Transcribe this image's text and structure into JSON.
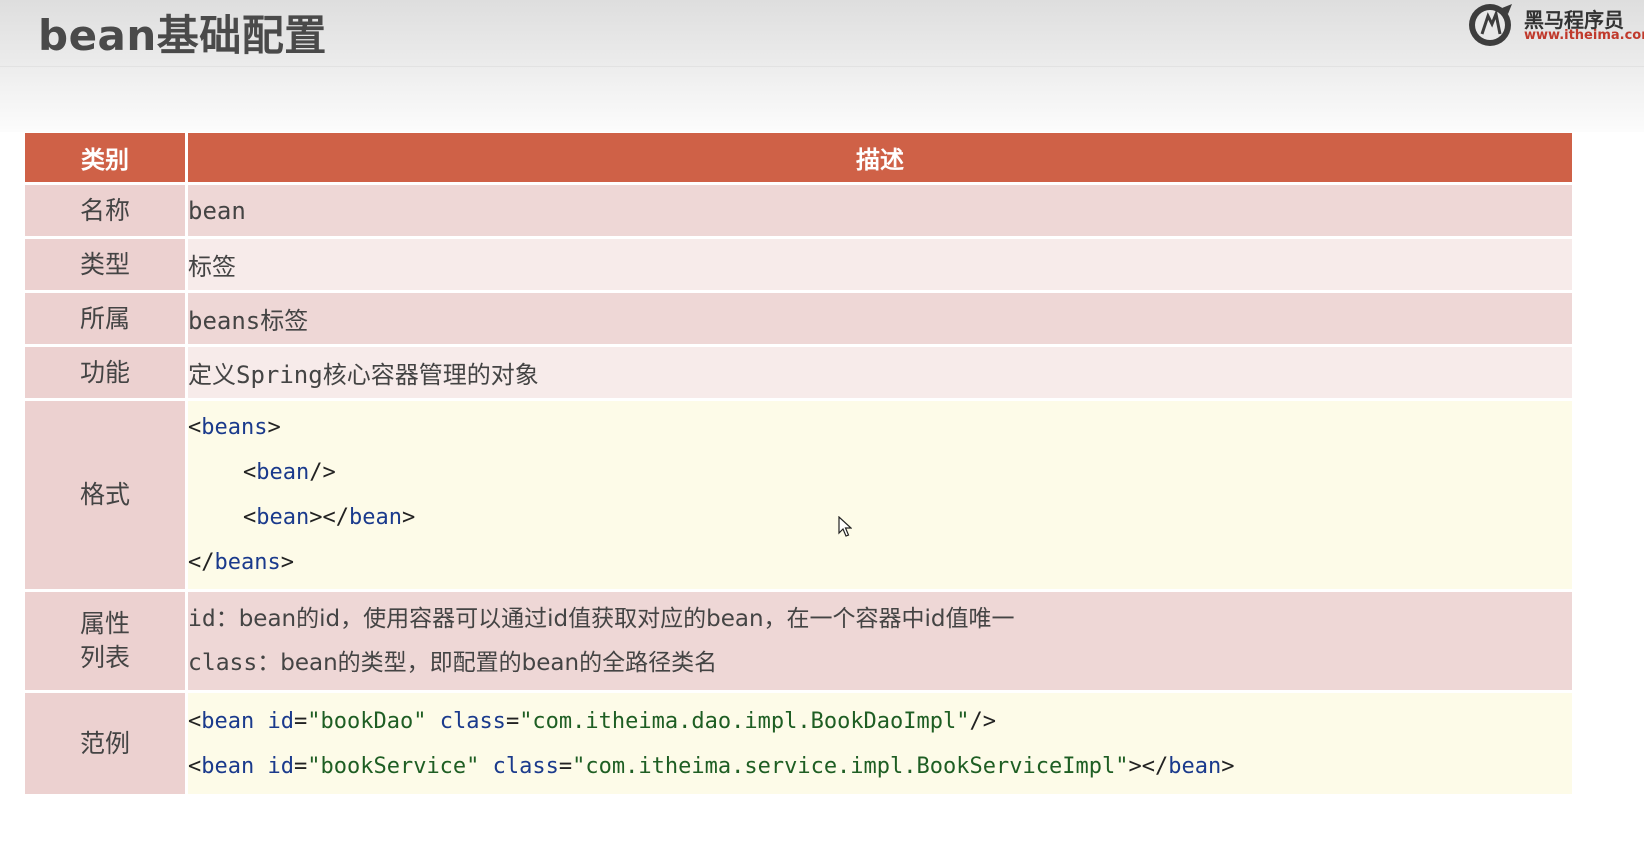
{
  "header": {
    "title": "bean基础配置",
    "logo": {
      "name": "黑马程序员",
      "url": "www.itheima.com"
    }
  },
  "table": {
    "headers": {
      "category": "类别",
      "description": "描述"
    },
    "rows": {
      "name": {
        "label": "名称",
        "value": "bean"
      },
      "type": {
        "label": "类型",
        "value": "标签"
      },
      "parent": {
        "label": "所属",
        "value": "beans标签"
      },
      "function": {
        "label": "功能",
        "value": "定义Spring核心容器管理的对象"
      },
      "format": {
        "label": "格式",
        "beans_open_tag": "beans",
        "bean_self_closing_tag": "bean",
        "bean_open_tag": "bean",
        "bean_close_tag": "bean",
        "beans_close_tag": "beans"
      },
      "attributes": {
        "label_line1": "属性",
        "label_line2": "列表",
        "id_name": "id",
        "id_desc": "bean的id，使用容器可以通过id值获取对应的bean，在一个容器中id值唯一",
        "class_name": "class",
        "class_desc": "bean的类型，即配置的bean的全路径类名"
      },
      "example": {
        "label": "范例",
        "line1": {
          "tag": "bean",
          "id_attr": "id",
          "id_value": "\"bookDao\"",
          "class_attr": "class",
          "class_value": "\"com.itheima.dao.impl.BookDaoImpl\""
        },
        "line2": {
          "tag": "bean",
          "id_attr": "id",
          "id_value": "\"bookService\"",
          "class_attr": "class",
          "class_value": "\"com.itheima.service.impl.BookServiceImpl\"",
          "close_tag": "bean"
        }
      }
    }
  },
  "colors": {
    "header_red": "#cf6147",
    "row_dark": "#eed7d6",
    "row_light": "#f7ebea",
    "code_bg": "#fdfbe8",
    "tag_blue": "#1a3a8c",
    "string_green": "#1e5e23"
  }
}
